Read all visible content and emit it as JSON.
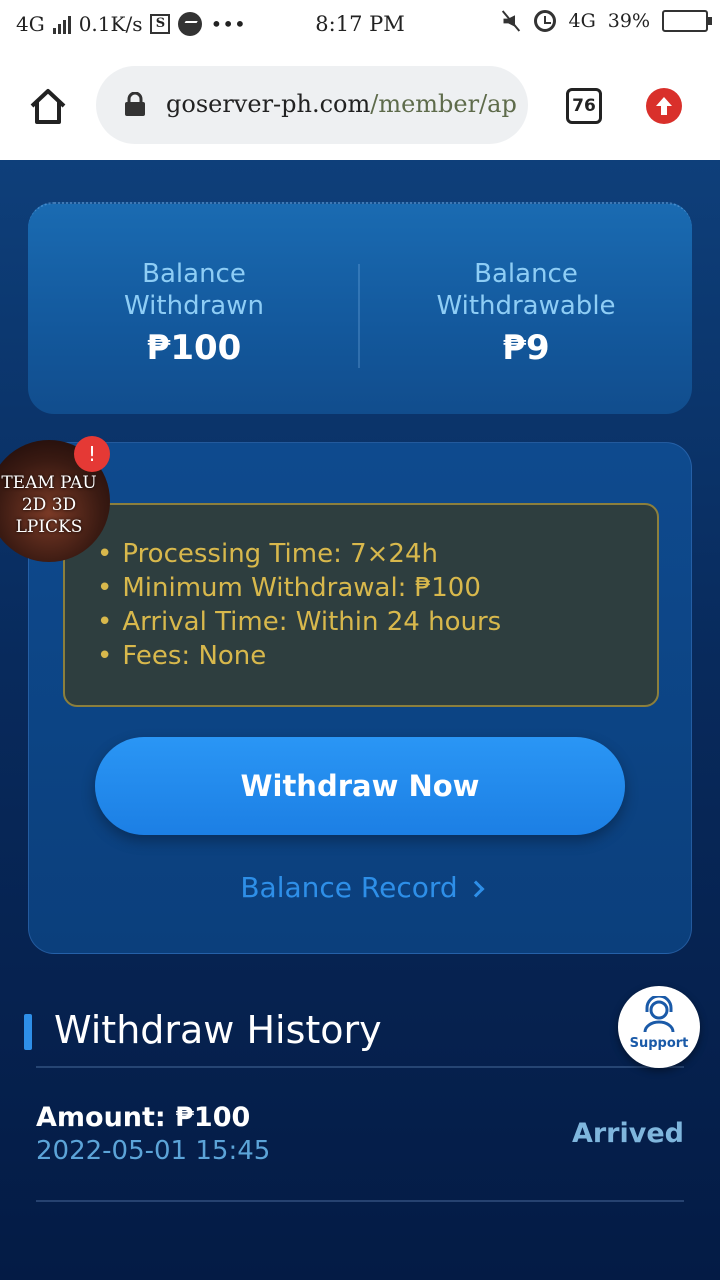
{
  "status_bar": {
    "network": "4G",
    "speed": "0.1K/s",
    "time": "8:17 PM",
    "network_right": "4G",
    "battery": "39%",
    "battery_level": 0.39
  },
  "browser": {
    "url_domain": "goserver-ph.com",
    "url_path": "/member/ap",
    "tab_count": "76"
  },
  "balance": {
    "withdrawn_label": "Balance Withdrawn",
    "withdrawn_amount": "₱100",
    "withdrawable_label": "Balance Withdrawable",
    "withdrawable_amount": "₱9"
  },
  "bubble": {
    "line1": "TEAM PAU",
    "line2": "2D 3D",
    "line3": "LPICKS",
    "badge": "!"
  },
  "info": [
    "Processing Time: 7×24h",
    "Minimum Withdrawal: ₱100",
    "Arrival Time: Within 24 hours",
    "Fees: None"
  ],
  "actions": {
    "withdraw_now": "Withdraw Now",
    "balance_record": "Balance Record"
  },
  "history": {
    "title": "Withdraw History",
    "rows": [
      {
        "amount": "Amount: ₱100",
        "date": "2022-05-01 15:45",
        "status": "Arrived"
      }
    ]
  },
  "support": {
    "label": "Support"
  },
  "colors": {
    "accent": "#2e8fe8",
    "info_text": "#d8b84c",
    "status_arrived": "#7fb6dd"
  }
}
